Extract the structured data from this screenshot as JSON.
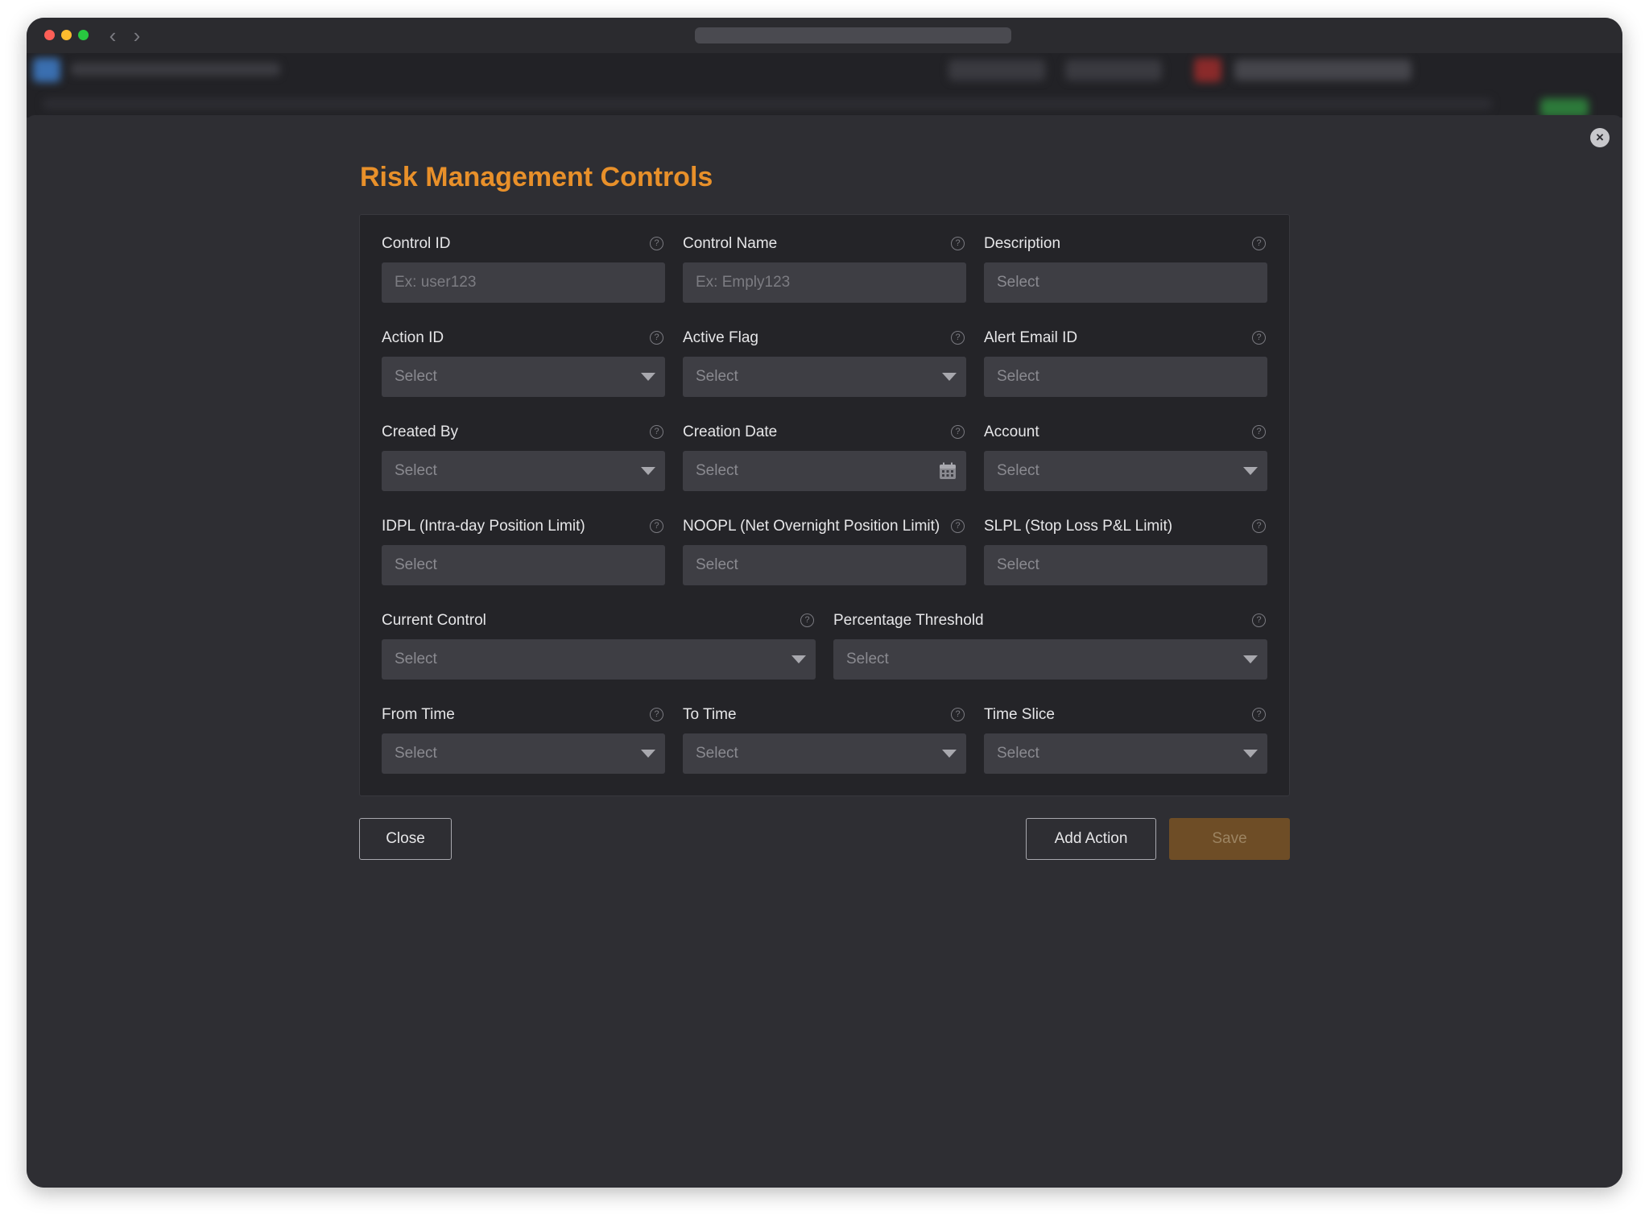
{
  "modal": {
    "title": "Risk Management Controls",
    "close_icon": "close-icon",
    "fields": {
      "control_id": {
        "label": "Control ID",
        "placeholder": "Ex: user123"
      },
      "control_name": {
        "label": "Control Name",
        "placeholder": "Ex: Emply123"
      },
      "description": {
        "label": "Description",
        "value": "Select"
      },
      "action_id": {
        "label": "Action ID",
        "value": "Select"
      },
      "active_flag": {
        "label": "Active Flag",
        "value": "Select"
      },
      "alert_email_id": {
        "label": "Alert Email ID",
        "value": "Select"
      },
      "created_by": {
        "label": "Created By",
        "value": "Select"
      },
      "creation_date": {
        "label": "Creation Date",
        "value": "Select"
      },
      "account": {
        "label": "Account",
        "value": "Select"
      },
      "idpl": {
        "label": "IDPL (Intra-day Position Limit)",
        "value": "Select"
      },
      "noopl": {
        "label": "NOOPL (Net Overnight Position Limit)",
        "value": "Select"
      },
      "slpl": {
        "label": "SLPL (Stop Loss P&L Limit)",
        "value": "Select"
      },
      "current_control": {
        "label": "Current Control",
        "value": "Select"
      },
      "percentage_threshold": {
        "label": "Percentage Threshold",
        "value": "Select"
      },
      "from_time": {
        "label": "From Time",
        "value": "Select"
      },
      "to_time": {
        "label": "To Time",
        "value": "Select"
      },
      "time_slice": {
        "label": "Time Slice",
        "value": "Select"
      }
    },
    "buttons": {
      "close": "Close",
      "add_action": "Add Action",
      "save": "Save"
    }
  },
  "colors": {
    "accent": "#e8902a",
    "save_button": "#6e4d26",
    "panel": "#242428",
    "input": "#3e3e44"
  }
}
